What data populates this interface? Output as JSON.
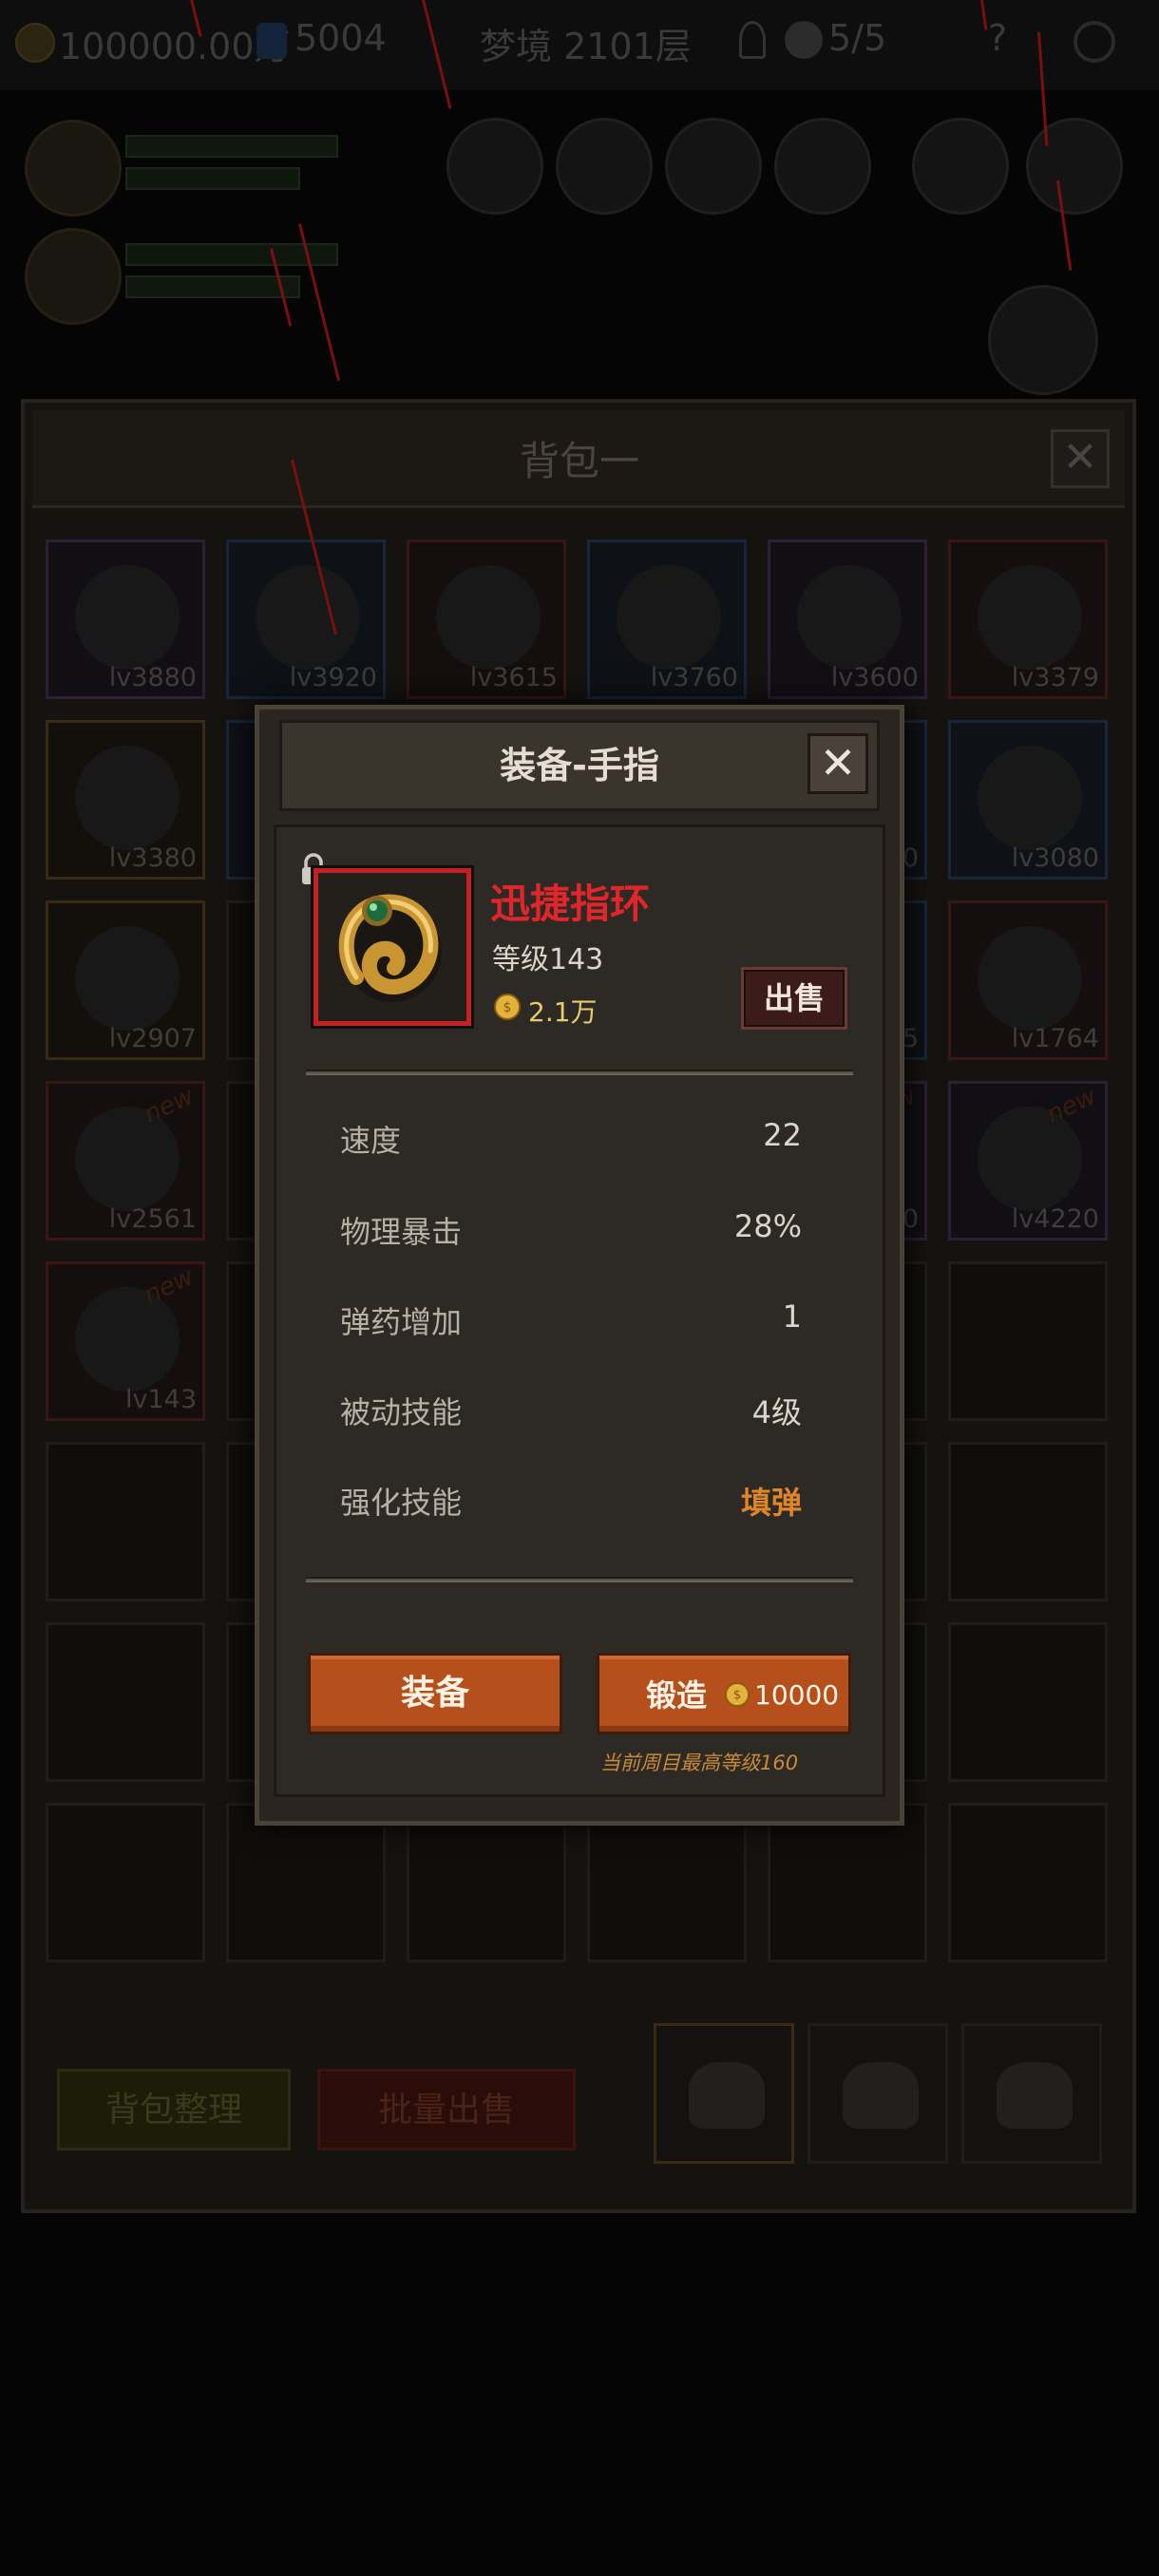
{
  "topbar": {
    "gold": "100000.00万",
    "gems": "5004",
    "stage": "梦境 2101层",
    "skulls": "5/5",
    "help": "?"
  },
  "bag": {
    "title": "背包一",
    "close": "✕",
    "sort_label": "背包整理",
    "bulk_sell_label": "批量出售",
    "slots": [
      {
        "level": "lv3880",
        "rarity": "purple",
        "new": ""
      },
      {
        "level": "lv3920",
        "rarity": "blue",
        "new": ""
      },
      {
        "level": "lv3615",
        "rarity": "red",
        "new": ""
      },
      {
        "level": "lv3760",
        "rarity": "blue",
        "new": ""
      },
      {
        "level": "lv3600",
        "rarity": "purple",
        "new": ""
      },
      {
        "level": "lv3379",
        "rarity": "red",
        "new": ""
      },
      {
        "level": "lv3380",
        "rarity": "orange",
        "new": ""
      },
      {
        "level": "",
        "rarity": "blue",
        "new": ""
      },
      {
        "level": "",
        "rarity": "none",
        "new": ""
      },
      {
        "level": "",
        "rarity": "none",
        "new": ""
      },
      {
        "level": "80",
        "rarity": "blue",
        "new": ""
      },
      {
        "level": "lv3080",
        "rarity": "blue",
        "new": ""
      },
      {
        "level": "lv2907",
        "rarity": "orange",
        "new": ""
      },
      {
        "level": "",
        "rarity": "none",
        "new": ""
      },
      {
        "level": "",
        "rarity": "none",
        "new": ""
      },
      {
        "level": "",
        "rarity": "none",
        "new": ""
      },
      {
        "level": "05",
        "rarity": "blue",
        "new": ""
      },
      {
        "level": "lv1764",
        "rarity": "red",
        "new": ""
      },
      {
        "level": "lv2561",
        "rarity": "red",
        "new": "new"
      },
      {
        "level": "",
        "rarity": "none",
        "new": ""
      },
      {
        "level": "",
        "rarity": "none",
        "new": ""
      },
      {
        "level": "",
        "rarity": "none",
        "new": ""
      },
      {
        "level": "20",
        "rarity": "purple",
        "new": "new"
      },
      {
        "level": "lv4220",
        "rarity": "purple",
        "new": "new"
      },
      {
        "level": "lv143",
        "rarity": "red",
        "new": "new"
      }
    ]
  },
  "modal": {
    "title": "装备-手指",
    "close": "✕",
    "item_name": "迅捷指环",
    "item_level": "等级143",
    "price": "2.1万",
    "sell_label": "出售",
    "stats": [
      {
        "label": "速度",
        "value": "22"
      },
      {
        "label": "物理暴击",
        "value": "28%"
      },
      {
        "label": "弹药增加",
        "value": "1"
      },
      {
        "label": "被动技能",
        "value": "4级"
      },
      {
        "label": "强化技能",
        "value": "填弹"
      }
    ],
    "equip_label": "装备",
    "forge_label": "锻造",
    "forge_cost": "10000",
    "forge_note": "当前周目最高等级160"
  },
  "colors": {
    "item_name": "#e0262b",
    "highlight_stat": "#e0862a",
    "button": "#b5501d",
    "price": "#e7cc6a",
    "item_frame": "#c42222"
  },
  "icons": {
    "lock": "lock-icon",
    "gold": "gold-coin-icon",
    "item": "ring-icon",
    "bag_tab": "backpack-icon"
  }
}
